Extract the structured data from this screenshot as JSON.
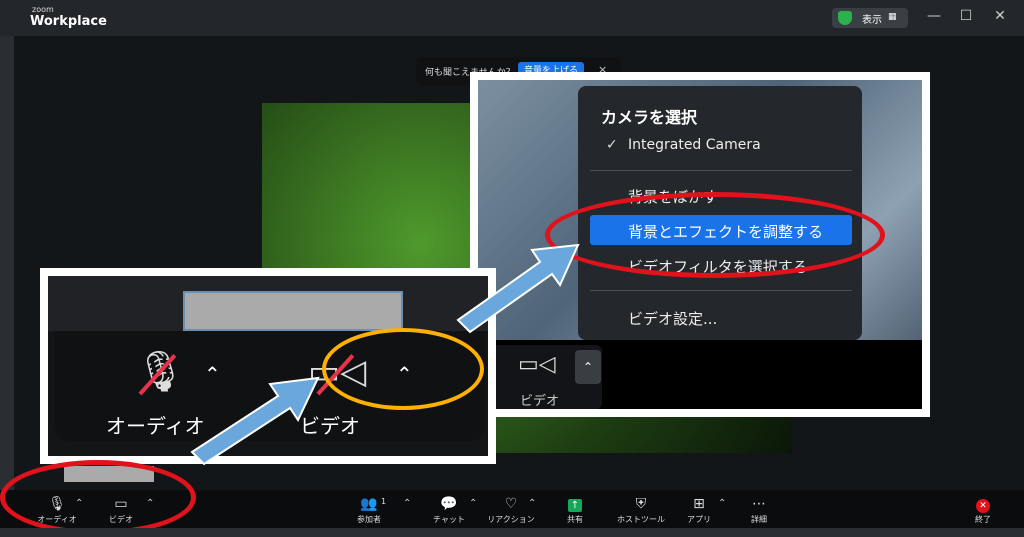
{
  "window": {
    "app_name_small": "zoom",
    "app_name": "Workplace",
    "show_button": "表示",
    "controls": [
      "—",
      "☐",
      "✕"
    ]
  },
  "notice": {
    "text": "何も聞こえませんか？",
    "button": "音量を上げる",
    "close": "×"
  },
  "toolbar": {
    "audio": "オーディオ",
    "video": "ビデオ",
    "participants": "参加者",
    "participants_count": "1",
    "chat": "チャット",
    "reactions": "リアクション",
    "share": "共有",
    "host_tools": "ホストツール",
    "apps": "アプリ",
    "more": "詳細",
    "end": "終了"
  },
  "callout_left": {
    "audio_label": "オーディオ",
    "video_label": "ビデオ"
  },
  "callout_right": {
    "video_label": "ビデオ",
    "menu": {
      "title": "カメラを選択",
      "camera": "Integrated Camera",
      "items": [
        "背景をぼかす",
        "背景とエフェクトを調整する",
        "ビデオフィルタを選択する",
        "ビデオ設定..."
      ]
    }
  },
  "colors": {
    "accent": "#1a73e8",
    "highlight_ring": "#e0121b",
    "secondary_ring": "#ffb000",
    "arrow": "#6aa7dd",
    "share_green": "#13a85a"
  }
}
